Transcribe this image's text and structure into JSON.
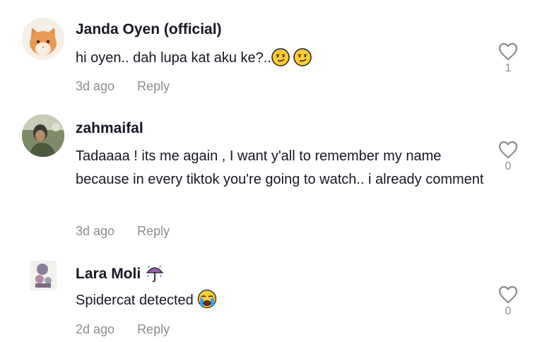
{
  "comments": [
    {
      "username": "Janda Oyen (official)",
      "text": "hi oyen.. dah lupa kat aku ke?..",
      "time": "3d ago",
      "reply": "Reply",
      "likes": "1",
      "emoji": [
        "smirk-emoji",
        "smirk-emoji"
      ]
    },
    {
      "username": "zahmaifal",
      "text": "Tadaaaa ! its me again , I want y'all to remember my name because in every tiktok you're going to watch.. i already comment",
      "time": "3d ago",
      "reply": "Reply",
      "likes": "0"
    },
    {
      "username": "Lara Moli",
      "username_emoji": "umbrella-rain-emoji",
      "text": "Spidercat detected",
      "time": "2d ago",
      "reply": "Reply",
      "likes": "0",
      "emoji": [
        "crying-face-emoji"
      ]
    }
  ]
}
